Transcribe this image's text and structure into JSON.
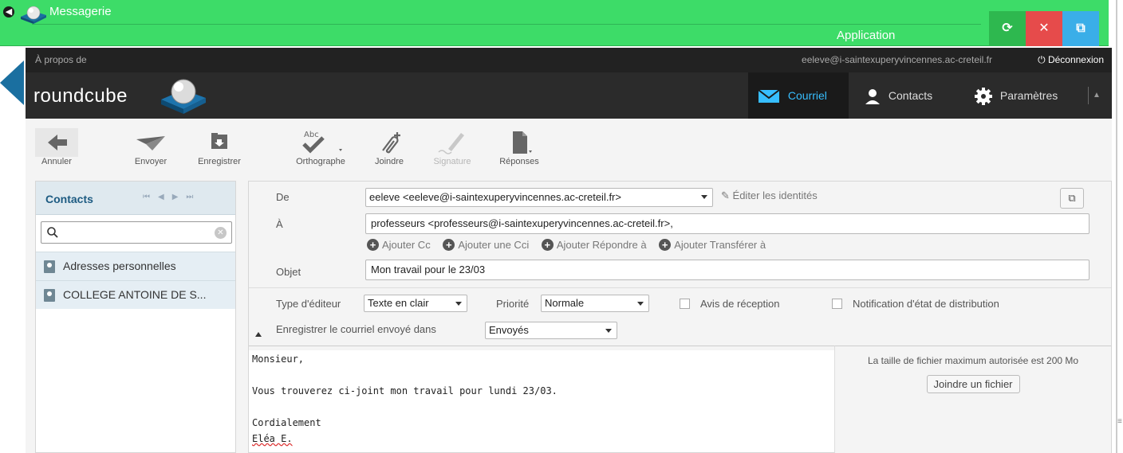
{
  "app": {
    "title": "Messagerie",
    "subtitle": "Application",
    "window_buttons": [
      "refresh-icon",
      "close-icon",
      "popout-icon"
    ]
  },
  "topline": {
    "about": "À propos de",
    "user": "eeleve@i-saintexuperyvincennes.ac-creteil.fr",
    "logout": "Déconnexion"
  },
  "header": {
    "logo": "roundcube"
  },
  "nav": {
    "mail": "Courriel",
    "contacts": "Contacts",
    "settings": "Paramètres"
  },
  "toolbar": {
    "cancel": "Annuler",
    "send": "Envoyer",
    "save": "Enregistrer",
    "spell": "Orthographe",
    "attach": "Joindre",
    "signature": "Signature",
    "responses": "Réponses"
  },
  "contacts": {
    "title": "Contacts",
    "search_placeholder": "",
    "items": [
      "Adresses personnelles",
      "COLLEGE ANTOINE DE S..."
    ]
  },
  "compose": {
    "from_label": "De",
    "from_value": "eeleve <eeleve@i-saintexuperyvincennes.ac-creteil.fr>",
    "edit_identities": "Éditer les identités",
    "to_label": "À",
    "to_value": "professeurs <professeurs@i-saintexuperyvincennes.ac-creteil.fr>,",
    "add_cc": "Ajouter Cc",
    "add_bcc": "Ajouter une Cci",
    "add_reply": "Ajouter Répondre à",
    "add_forward": "Ajouter Transférer à",
    "subject_label": "Objet",
    "subject_value": "Mon travail pour le 23/03",
    "editor_type_label": "Type d'éditeur",
    "editor_type_value": "Texte en clair",
    "priority_label": "Priorité",
    "priority_value": "Normale",
    "receipt_label": "Avis de réception",
    "dsn_label": "Notification d'état de distribution",
    "store_label": "Enregistrer le courriel envoyé dans",
    "store_value": "Envoyés",
    "body": [
      "Monsieur,",
      "",
      "Vous trouverez ci-joint mon travail pour lundi 23/03.",
      "",
      "Cordialement",
      "Eléa E."
    ]
  },
  "attachment": {
    "max_size_text": "La taille de fichier maximum autorisée est 200 Mo",
    "button": "Joindre un fichier"
  },
  "colors": {
    "app_bar": "#3ddc68",
    "accent": "#37beff",
    "header": "#2b2b2b"
  }
}
